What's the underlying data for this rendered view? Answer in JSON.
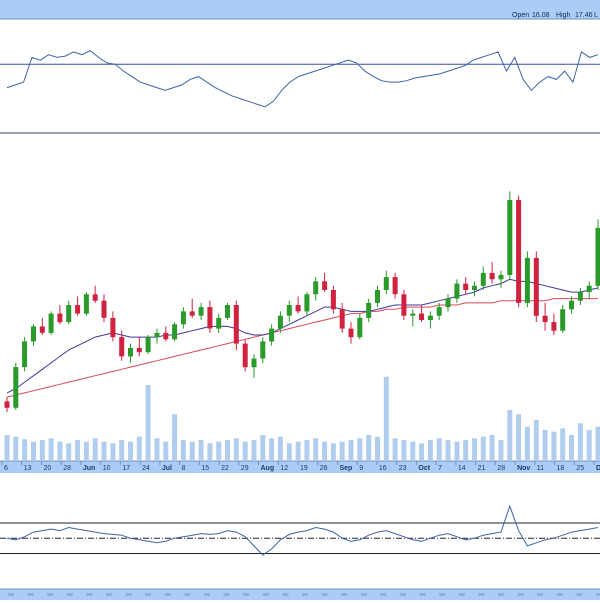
{
  "header": {
    "open_label": "Open",
    "open_value": "16.08",
    "high_label": "High",
    "high_value": "17.46",
    "trailing": "L"
  },
  "colors": {
    "header_bg": "#a9cdf7",
    "axis_bar_bg": "#a9cdf7",
    "up_candle": "#2a9a2a",
    "down_candle": "#d0213f",
    "ma_short": "#3a3a9a",
    "ma_long": "#d84a5a",
    "volume": "#b0cdee",
    "indicator_line": "#3d64a8",
    "panel_border": "#334466"
  },
  "x_axis": {
    "labels": [
      "6",
      "13",
      "20",
      "28",
      "Jun",
      "10",
      "17",
      "24",
      "Jul",
      "8",
      "15",
      "22",
      "29",
      "Aug",
      "12",
      "19",
      "26",
      "Sep",
      "9",
      "16",
      "23",
      "Oct",
      "7",
      "14",
      "21",
      "28",
      "Nov",
      "11",
      "18",
      "25",
      "Dec"
    ],
    "month_labels": [
      "Jun",
      "Jul",
      "Aug",
      "Sep",
      "Oct",
      "Nov",
      "Dec"
    ]
  },
  "chart_data": [
    {
      "type": "line",
      "panel": "top-indicator",
      "series": [
        {
          "values": [
            58,
            60,
            62,
            80,
            78,
            82,
            80,
            81,
            84,
            82,
            85,
            80,
            76,
            75,
            70,
            66,
            62,
            60,
            58,
            56,
            58,
            60,
            64,
            66,
            62,
            58,
            55,
            52,
            50,
            48,
            46,
            44,
            48,
            56,
            62,
            66,
            68,
            70,
            72,
            74,
            76,
            78,
            76,
            70,
            66,
            63,
            62,
            62,
            63,
            65,
            66,
            67,
            68,
            70,
            72,
            74,
            78,
            80,
            82,
            84,
            70,
            80,
            64,
            56,
            62,
            66,
            64,
            70,
            62,
            84,
            80,
            82
          ]
        }
      ],
      "reference_level": 75
    },
    {
      "type": "candlestick",
      "panel": "price",
      "candles": [
        [
          11.8,
          12.0,
          11.3,
          11.5
        ],
        [
          11.5,
          13.6,
          11.4,
          13.4
        ],
        [
          13.4,
          14.8,
          13.2,
          14.6
        ],
        [
          14.6,
          15.4,
          14.4,
          15.3
        ],
        [
          15.3,
          15.7,
          14.9,
          15.0
        ],
        [
          15.0,
          16.0,
          14.9,
          15.9
        ],
        [
          15.9,
          16.3,
          15.4,
          15.5
        ],
        [
          15.5,
          16.5,
          15.4,
          16.3
        ],
        [
          16.3,
          16.7,
          15.8,
          15.9
        ],
        [
          15.9,
          16.9,
          15.8,
          16.8
        ],
        [
          16.8,
          17.2,
          16.4,
          16.5
        ],
        [
          16.5,
          16.8,
          15.5,
          15.7
        ],
        [
          15.7,
          16.0,
          14.6,
          14.8
        ],
        [
          14.8,
          15.1,
          13.7,
          13.9
        ],
        [
          13.9,
          14.5,
          13.6,
          14.3
        ],
        [
          14.3,
          14.8,
          13.9,
          14.1
        ],
        [
          14.1,
          14.9,
          14.0,
          14.8
        ],
        [
          14.8,
          15.2,
          14.5,
          15.0
        ],
        [
          15.0,
          15.3,
          14.6,
          14.7
        ],
        [
          14.7,
          15.5,
          14.6,
          15.4
        ],
        [
          15.4,
          16.2,
          15.2,
          16.0
        ],
        [
          16.0,
          16.6,
          15.7,
          15.8
        ],
        [
          15.8,
          16.4,
          15.6,
          16.2
        ],
        [
          16.2,
          16.5,
          15.0,
          15.2
        ],
        [
          15.2,
          15.9,
          15.0,
          15.7
        ],
        [
          15.7,
          16.4,
          15.6,
          16.3
        ],
        [
          16.3,
          16.5,
          14.2,
          14.5
        ],
        [
          14.5,
          14.7,
          13.2,
          13.4
        ],
        [
          13.4,
          14.0,
          12.9,
          13.8
        ],
        [
          13.8,
          14.8,
          13.6,
          14.6
        ],
        [
          14.6,
          15.4,
          14.4,
          15.2
        ],
        [
          15.2,
          16.0,
          15.0,
          15.8
        ],
        [
          15.8,
          16.5,
          15.5,
          16.3
        ],
        [
          16.3,
          16.7,
          15.9,
          16.0
        ],
        [
          16.0,
          16.9,
          15.8,
          16.8
        ],
        [
          16.8,
          17.6,
          16.5,
          17.4
        ],
        [
          17.4,
          17.8,
          16.9,
          17.0
        ],
        [
          17.0,
          17.2,
          15.9,
          16.1
        ],
        [
          16.1,
          16.4,
          15.0,
          15.2
        ],
        [
          15.2,
          15.5,
          14.5,
          14.8
        ],
        [
          14.8,
          15.9,
          14.7,
          15.7
        ],
        [
          15.7,
          16.6,
          15.5,
          16.4
        ],
        [
          16.4,
          17.2,
          16.2,
          17.0
        ],
        [
          17.0,
          17.9,
          16.8,
          17.6
        ],
        [
          17.6,
          17.8,
          16.6,
          16.8
        ],
        [
          16.8,
          17.0,
          15.6,
          15.8
        ],
        [
          15.8,
          16.1,
          15.3,
          15.9
        ],
        [
          15.9,
          16.3,
          15.5,
          15.6
        ],
        [
          15.6,
          16.0,
          15.2,
          15.8
        ],
        [
          15.8,
          16.4,
          15.6,
          16.2
        ],
        [
          16.2,
          16.8,
          16.0,
          16.6
        ],
        [
          16.6,
          17.5,
          16.4,
          17.3
        ],
        [
          17.3,
          17.6,
          16.8,
          17.0
        ],
        [
          17.0,
          17.4,
          16.7,
          17.2
        ],
        [
          17.2,
          18.1,
          17.0,
          17.8
        ],
        [
          17.8,
          18.3,
          17.3,
          17.5
        ],
        [
          17.5,
          17.9,
          17.1,
          17.7
        ],
        [
          17.7,
          21.6,
          17.5,
          21.2
        ],
        [
          21.2,
          21.4,
          16.2,
          16.4
        ],
        [
          16.4,
          18.8,
          16.2,
          18.5
        ],
        [
          18.5,
          18.8,
          15.5,
          15.8
        ],
        [
          15.8,
          16.4,
          15.1,
          15.5
        ],
        [
          15.5,
          15.9,
          14.9,
          15.1
        ],
        [
          15.1,
          16.3,
          15.0,
          16.1
        ],
        [
          16.1,
          16.7,
          15.9,
          16.5
        ],
        [
          16.5,
          17.1,
          16.3,
          16.9
        ],
        [
          16.9,
          17.4,
          16.6,
          17.2
        ],
        [
          17.2,
          20.3,
          17.0,
          19.9
        ]
      ],
      "ma_short": [
        12.2,
        12.4,
        12.7,
        13.0,
        13.3,
        13.6,
        13.9,
        14.2,
        14.4,
        14.6,
        14.8,
        14.9,
        15.0,
        14.9,
        14.8,
        14.8,
        14.8,
        14.8,
        14.9,
        14.9,
        15.0,
        15.1,
        15.2,
        15.3,
        15.3,
        15.3,
        15.2,
        15.0,
        14.9,
        14.9,
        15.0,
        15.2,
        15.4,
        15.6,
        15.8,
        16.0,
        16.2,
        16.2,
        16.1,
        16.0,
        16.0,
        16.0,
        16.1,
        16.2,
        16.3,
        16.3,
        16.3,
        16.3,
        16.4,
        16.5,
        16.6,
        16.7,
        16.8,
        16.9,
        17.1,
        17.2,
        17.3,
        17.5,
        17.4,
        17.4,
        17.3,
        17.2,
        17.1,
        17.0,
        16.9,
        16.9,
        17.0,
        17.1
      ],
      "ma_long": [
        12.0,
        12.1,
        12.2,
        12.3,
        12.4,
        12.5,
        12.6,
        12.7,
        12.8,
        12.9,
        13.0,
        13.1,
        13.2,
        13.3,
        13.4,
        13.5,
        13.6,
        13.7,
        13.8,
        13.9,
        14.0,
        14.1,
        14.2,
        14.3,
        14.4,
        14.5,
        14.6,
        14.7,
        14.8,
        14.9,
        15.0,
        15.1,
        15.2,
        15.3,
        15.4,
        15.5,
        15.6,
        15.7,
        15.8,
        15.9,
        15.9,
        16.0,
        16.0,
        16.1,
        16.1,
        16.2,
        16.2,
        16.2,
        16.2,
        16.3,
        16.3,
        16.3,
        16.4,
        16.4,
        16.4,
        16.4,
        16.5,
        16.5,
        16.5,
        16.5,
        16.5,
        16.5,
        16.6,
        16.6,
        16.6,
        16.6,
        16.6,
        16.6
      ],
      "volume": [
        30,
        28,
        25,
        22,
        24,
        26,
        22,
        20,
        24,
        22,
        26,
        22,
        20,
        24,
        22,
        28,
        90,
        26,
        22,
        55,
        24,
        22,
        24,
        20,
        22,
        24,
        26,
        22,
        24,
        30,
        26,
        28,
        20,
        22,
        24,
        26,
        22,
        20,
        22,
        24,
        26,
        30,
        28,
        100,
        26,
        24,
        22,
        20,
        24,
        26,
        24,
        22,
        24,
        26,
        28,
        30,
        24,
        60,
        55,
        40,
        48,
        36,
        34,
        38,
        30,
        44,
        36,
        40
      ]
    },
    {
      "type": "line",
      "panel": "bottom-indicator",
      "series": [
        {
          "values": [
            50,
            48,
            52,
            58,
            60,
            62,
            60,
            64,
            62,
            60,
            58,
            56,
            55,
            54,
            50,
            48,
            46,
            44,
            46,
            50,
            52,
            54,
            56,
            55,
            56,
            60,
            58,
            52,
            40,
            28,
            36,
            48,
            55,
            58,
            60,
            64,
            62,
            58,
            50,
            46,
            48,
            54,
            58,
            60,
            56,
            52,
            48,
            46,
            50,
            54,
            56,
            52,
            48,
            50,
            54,
            56,
            58,
            92,
            60,
            40,
            44,
            48,
            50,
            54,
            58,
            60,
            62,
            64
          ]
        }
      ],
      "levels": [
        70,
        50,
        30
      ]
    }
  ]
}
